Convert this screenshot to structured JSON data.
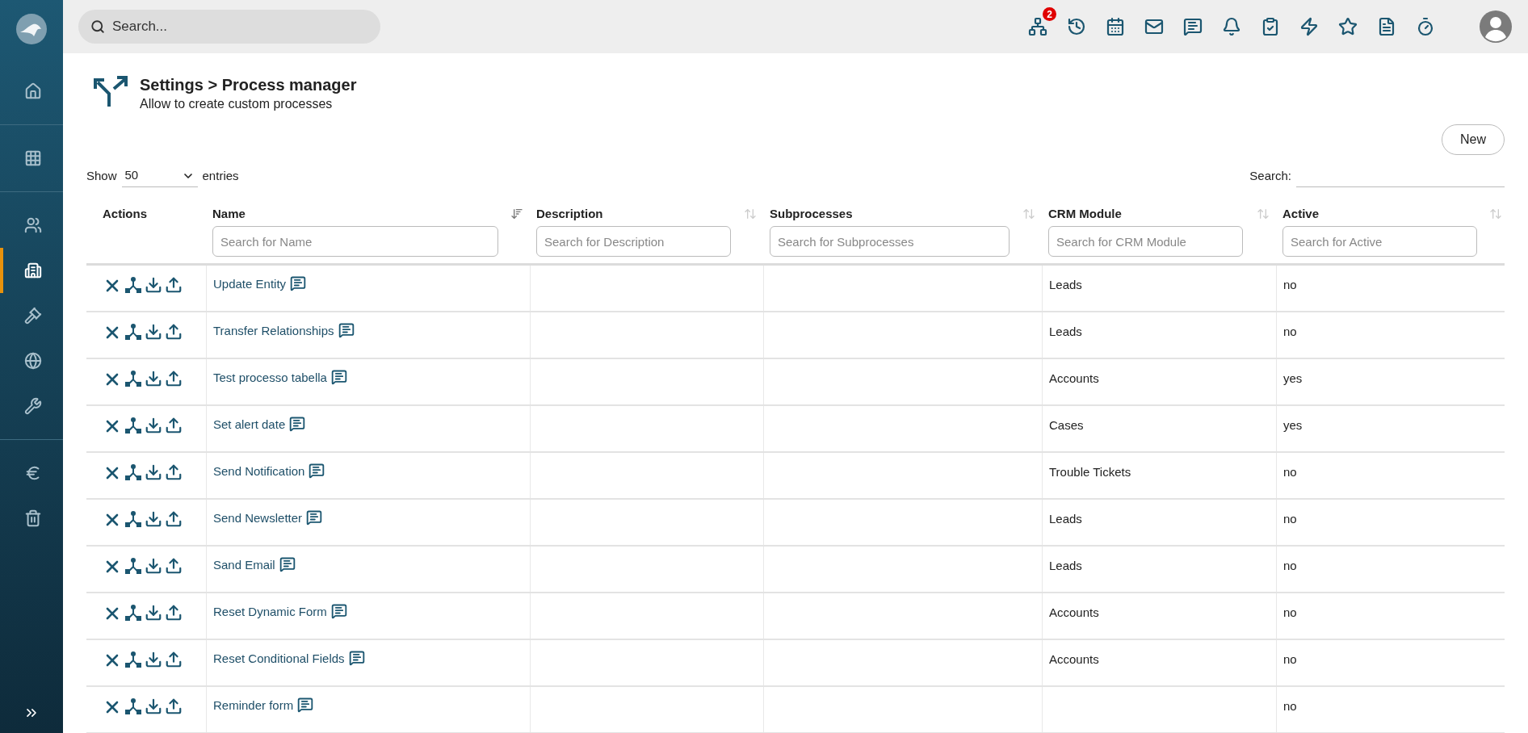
{
  "sidebar": {
    "groups": [
      [
        {
          "kind": "home",
          "selected": false
        }
      ],
      [
        {
          "kind": "grid",
          "selected": false
        }
      ],
      [
        {
          "kind": "people",
          "selected": false
        },
        {
          "kind": "building",
          "selected": true
        },
        {
          "kind": "gavel",
          "selected": false
        },
        {
          "kind": "globe",
          "selected": false
        },
        {
          "kind": "wrench",
          "selected": false
        }
      ],
      [
        {
          "kind": "euro",
          "selected": false
        },
        {
          "kind": "trash",
          "selected": false
        }
      ]
    ]
  },
  "topbar": {
    "search": {
      "placeholder": "Search..."
    },
    "icons": [
      {
        "kind": "workflow",
        "badge": "2"
      },
      {
        "kind": "history"
      },
      {
        "kind": "calendar"
      },
      {
        "kind": "mail"
      },
      {
        "kind": "chat"
      },
      {
        "kind": "bell"
      },
      {
        "kind": "task"
      },
      {
        "kind": "bolt"
      },
      {
        "kind": "star"
      },
      {
        "kind": "document"
      },
      {
        "kind": "timer"
      }
    ]
  },
  "page": {
    "title": "Settings > Process manager",
    "subtitle": "Allow to create custom processes",
    "new_button": "New",
    "length": {
      "before": "Show",
      "value": "50",
      "after": "entries"
    },
    "search_label": "Search:"
  },
  "table": {
    "columns": [
      {
        "label": "Actions"
      },
      {
        "label": "Name",
        "placeholder": "Search for Name",
        "sorted": true
      },
      {
        "label": "Description",
        "placeholder": "Search for Description",
        "sorted": false
      },
      {
        "label": "Subprocesses",
        "placeholder": "Search for Subprocesses",
        "sorted": false
      },
      {
        "label": "CRM Module",
        "placeholder": "Search for CRM Module",
        "sorted": false
      },
      {
        "label": "Active",
        "placeholder": "Search for Active",
        "sorted": false
      }
    ],
    "rows": [
      {
        "name": "Update Entity",
        "crm_module": "Leads",
        "active": "no"
      },
      {
        "name": "Transfer Relationships",
        "crm_module": "Leads",
        "active": "no"
      },
      {
        "name": "Test processo tabella",
        "crm_module": "Accounts",
        "active": "yes"
      },
      {
        "name": "Set alert date",
        "crm_module": "Cases",
        "active": "yes"
      },
      {
        "name": "Send Notification",
        "crm_module": "Trouble Tickets",
        "active": "no"
      },
      {
        "name": "Send Newsletter",
        "crm_module": "Leads",
        "active": "no"
      },
      {
        "name": "Sand Email",
        "crm_module": "Leads",
        "active": "no"
      },
      {
        "name": "Reset Dynamic Form",
        "crm_module": "Accounts",
        "active": "no"
      },
      {
        "name": "Reset Conditional Fields",
        "crm_module": "Accounts",
        "active": "no"
      },
      {
        "name": "Reminder form",
        "active": "no"
      }
    ]
  }
}
